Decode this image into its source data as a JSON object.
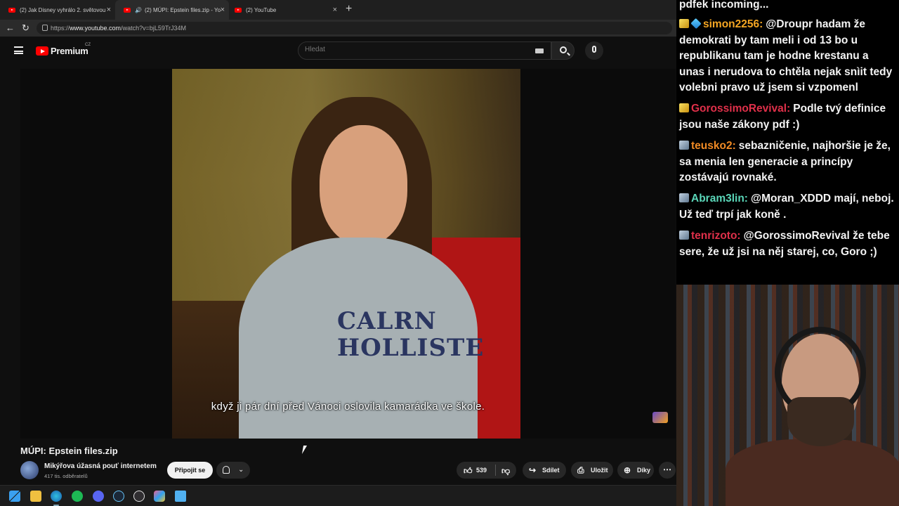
{
  "browser": {
    "tabs": [
      {
        "label": "(2) Jak Disney vyhrálo 2. světovou",
        "active": false
      },
      {
        "label": "(2) MÚPI: Epstein files.zip - Yo",
        "active": true
      },
      {
        "label": "(2) YouTube",
        "active": false
      }
    ],
    "url_prefix": "https://",
    "url_domain": "www.youtube.com",
    "url_rest": "/watch?v=bjL59TrJ34M"
  },
  "youtube": {
    "logo_text": "Premium",
    "region": "CZ",
    "search_placeholder": "Hledat"
  },
  "video": {
    "subtitle": "když ji pár dní před Vánoci oslovila kamarádka ve škole.",
    "frame_text": "CALRN\nHOLLISTE",
    "title": "MÚPI: Epstein files.zip",
    "channel_name": "Mikýřova úžasná pouť internetem",
    "channel_subs": "417 tis. odběratelů",
    "join_label": "Připojit se",
    "like_count": "539",
    "share_label": "Sdílet",
    "save_label": "Uložit",
    "thanks_label": "Díky"
  },
  "taskbar": {
    "icons": [
      "windows-start-icon",
      "file-explorer-icon",
      "edge-icon",
      "spotify-icon",
      "discord-icon",
      "steam-icon",
      "obs-icon",
      "copilot-icon",
      "notepad-icon"
    ]
  },
  "chat": {
    "messages": [
      {
        "user": "",
        "user_color": "#f4f4f4",
        "badges": [],
        "text": "pdfek incoming..."
      },
      {
        "user": "simon2256:",
        "user_color": "#f5a623",
        "badges": [
          "gold",
          "blue"
        ],
        "text": "@Droupr hadam že demokrati by tam meli i od 13 bo u republikanu tam je hodne krestanu a unas i nerudova to chtěla nejak snìit tedy volebni pravo už jsem si vzpomenl"
      },
      {
        "user": "GorossimoRevival:",
        "user_color": "#e0304a",
        "badges": [
          "gold"
        ],
        "text": "Podle tvý definice jsou naše zákony pdf :)"
      },
      {
        "user": "teusko2:",
        "user_color": "#f08a24",
        "badges": [
          "steel"
        ],
        "text": "sebazničenie, najhoršie je že, sa menia len generacie a princípy zostávajú rovnaké."
      },
      {
        "user": "Abram3lin:",
        "user_color": "#5ad6b8",
        "badges": [
          "steel"
        ],
        "text": "@Moran_XDDD mají, neboj. Už teď trpí jak koně ."
      },
      {
        "user": "tenrizoto:",
        "user_color": "#e0304a",
        "badges": [
          "steel"
        ],
        "text": "@GorossimoRevival že tebe sere, že už jsi na něj starej, co, Goro ;)"
      }
    ]
  }
}
